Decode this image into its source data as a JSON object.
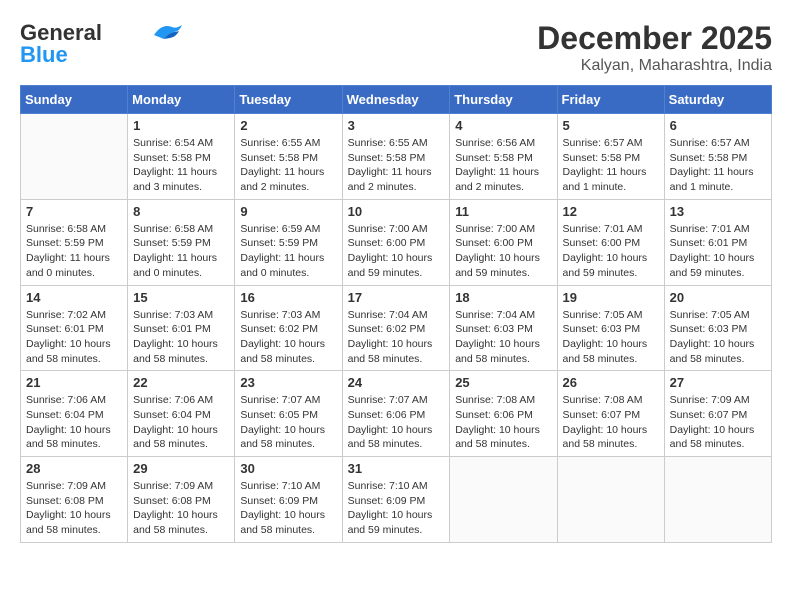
{
  "header": {
    "logo_general": "General",
    "logo_blue": "Blue",
    "month": "December 2025",
    "location": "Kalyan, Maharashtra, India"
  },
  "days_of_week": [
    "Sunday",
    "Monday",
    "Tuesday",
    "Wednesday",
    "Thursday",
    "Friday",
    "Saturday"
  ],
  "weeks": [
    [
      {
        "day": "",
        "sunrise": "",
        "sunset": "",
        "daylight": ""
      },
      {
        "day": "1",
        "sunrise": "Sunrise: 6:54 AM",
        "sunset": "Sunset: 5:58 PM",
        "daylight": "Daylight: 11 hours and 3 minutes."
      },
      {
        "day": "2",
        "sunrise": "Sunrise: 6:55 AM",
        "sunset": "Sunset: 5:58 PM",
        "daylight": "Daylight: 11 hours and 2 minutes."
      },
      {
        "day": "3",
        "sunrise": "Sunrise: 6:55 AM",
        "sunset": "Sunset: 5:58 PM",
        "daylight": "Daylight: 11 hours and 2 minutes."
      },
      {
        "day": "4",
        "sunrise": "Sunrise: 6:56 AM",
        "sunset": "Sunset: 5:58 PM",
        "daylight": "Daylight: 11 hours and 2 minutes."
      },
      {
        "day": "5",
        "sunrise": "Sunrise: 6:57 AM",
        "sunset": "Sunset: 5:58 PM",
        "daylight": "Daylight: 11 hours and 1 minute."
      },
      {
        "day": "6",
        "sunrise": "Sunrise: 6:57 AM",
        "sunset": "Sunset: 5:58 PM",
        "daylight": "Daylight: 11 hours and 1 minute."
      }
    ],
    [
      {
        "day": "7",
        "sunrise": "Sunrise: 6:58 AM",
        "sunset": "Sunset: 5:59 PM",
        "daylight": "Daylight: 11 hours and 0 minutes."
      },
      {
        "day": "8",
        "sunrise": "Sunrise: 6:58 AM",
        "sunset": "Sunset: 5:59 PM",
        "daylight": "Daylight: 11 hours and 0 minutes."
      },
      {
        "day": "9",
        "sunrise": "Sunrise: 6:59 AM",
        "sunset": "Sunset: 5:59 PM",
        "daylight": "Daylight: 11 hours and 0 minutes."
      },
      {
        "day": "10",
        "sunrise": "Sunrise: 7:00 AM",
        "sunset": "Sunset: 6:00 PM",
        "daylight": "Daylight: 10 hours and 59 minutes."
      },
      {
        "day": "11",
        "sunrise": "Sunrise: 7:00 AM",
        "sunset": "Sunset: 6:00 PM",
        "daylight": "Daylight: 10 hours and 59 minutes."
      },
      {
        "day": "12",
        "sunrise": "Sunrise: 7:01 AM",
        "sunset": "Sunset: 6:00 PM",
        "daylight": "Daylight: 10 hours and 59 minutes."
      },
      {
        "day": "13",
        "sunrise": "Sunrise: 7:01 AM",
        "sunset": "Sunset: 6:01 PM",
        "daylight": "Daylight: 10 hours and 59 minutes."
      }
    ],
    [
      {
        "day": "14",
        "sunrise": "Sunrise: 7:02 AM",
        "sunset": "Sunset: 6:01 PM",
        "daylight": "Daylight: 10 hours and 58 minutes."
      },
      {
        "day": "15",
        "sunrise": "Sunrise: 7:03 AM",
        "sunset": "Sunset: 6:01 PM",
        "daylight": "Daylight: 10 hours and 58 minutes."
      },
      {
        "day": "16",
        "sunrise": "Sunrise: 7:03 AM",
        "sunset": "Sunset: 6:02 PM",
        "daylight": "Daylight: 10 hours and 58 minutes."
      },
      {
        "day": "17",
        "sunrise": "Sunrise: 7:04 AM",
        "sunset": "Sunset: 6:02 PM",
        "daylight": "Daylight: 10 hours and 58 minutes."
      },
      {
        "day": "18",
        "sunrise": "Sunrise: 7:04 AM",
        "sunset": "Sunset: 6:03 PM",
        "daylight": "Daylight: 10 hours and 58 minutes."
      },
      {
        "day": "19",
        "sunrise": "Sunrise: 7:05 AM",
        "sunset": "Sunset: 6:03 PM",
        "daylight": "Daylight: 10 hours and 58 minutes."
      },
      {
        "day": "20",
        "sunrise": "Sunrise: 7:05 AM",
        "sunset": "Sunset: 6:03 PM",
        "daylight": "Daylight: 10 hours and 58 minutes."
      }
    ],
    [
      {
        "day": "21",
        "sunrise": "Sunrise: 7:06 AM",
        "sunset": "Sunset: 6:04 PM",
        "daylight": "Daylight: 10 hours and 58 minutes."
      },
      {
        "day": "22",
        "sunrise": "Sunrise: 7:06 AM",
        "sunset": "Sunset: 6:04 PM",
        "daylight": "Daylight: 10 hours and 58 minutes."
      },
      {
        "day": "23",
        "sunrise": "Sunrise: 7:07 AM",
        "sunset": "Sunset: 6:05 PM",
        "daylight": "Daylight: 10 hours and 58 minutes."
      },
      {
        "day": "24",
        "sunrise": "Sunrise: 7:07 AM",
        "sunset": "Sunset: 6:06 PM",
        "daylight": "Daylight: 10 hours and 58 minutes."
      },
      {
        "day": "25",
        "sunrise": "Sunrise: 7:08 AM",
        "sunset": "Sunset: 6:06 PM",
        "daylight": "Daylight: 10 hours and 58 minutes."
      },
      {
        "day": "26",
        "sunrise": "Sunrise: 7:08 AM",
        "sunset": "Sunset: 6:07 PM",
        "daylight": "Daylight: 10 hours and 58 minutes."
      },
      {
        "day": "27",
        "sunrise": "Sunrise: 7:09 AM",
        "sunset": "Sunset: 6:07 PM",
        "daylight": "Daylight: 10 hours and 58 minutes."
      }
    ],
    [
      {
        "day": "28",
        "sunrise": "Sunrise: 7:09 AM",
        "sunset": "Sunset: 6:08 PM",
        "daylight": "Daylight: 10 hours and 58 minutes."
      },
      {
        "day": "29",
        "sunrise": "Sunrise: 7:09 AM",
        "sunset": "Sunset: 6:08 PM",
        "daylight": "Daylight: 10 hours and 58 minutes."
      },
      {
        "day": "30",
        "sunrise": "Sunrise: 7:10 AM",
        "sunset": "Sunset: 6:09 PM",
        "daylight": "Daylight: 10 hours and 58 minutes."
      },
      {
        "day": "31",
        "sunrise": "Sunrise: 7:10 AM",
        "sunset": "Sunset: 6:09 PM",
        "daylight": "Daylight: 10 hours and 59 minutes."
      },
      {
        "day": "",
        "sunrise": "",
        "sunset": "",
        "daylight": ""
      },
      {
        "day": "",
        "sunrise": "",
        "sunset": "",
        "daylight": ""
      },
      {
        "day": "",
        "sunrise": "",
        "sunset": "",
        "daylight": ""
      }
    ]
  ]
}
